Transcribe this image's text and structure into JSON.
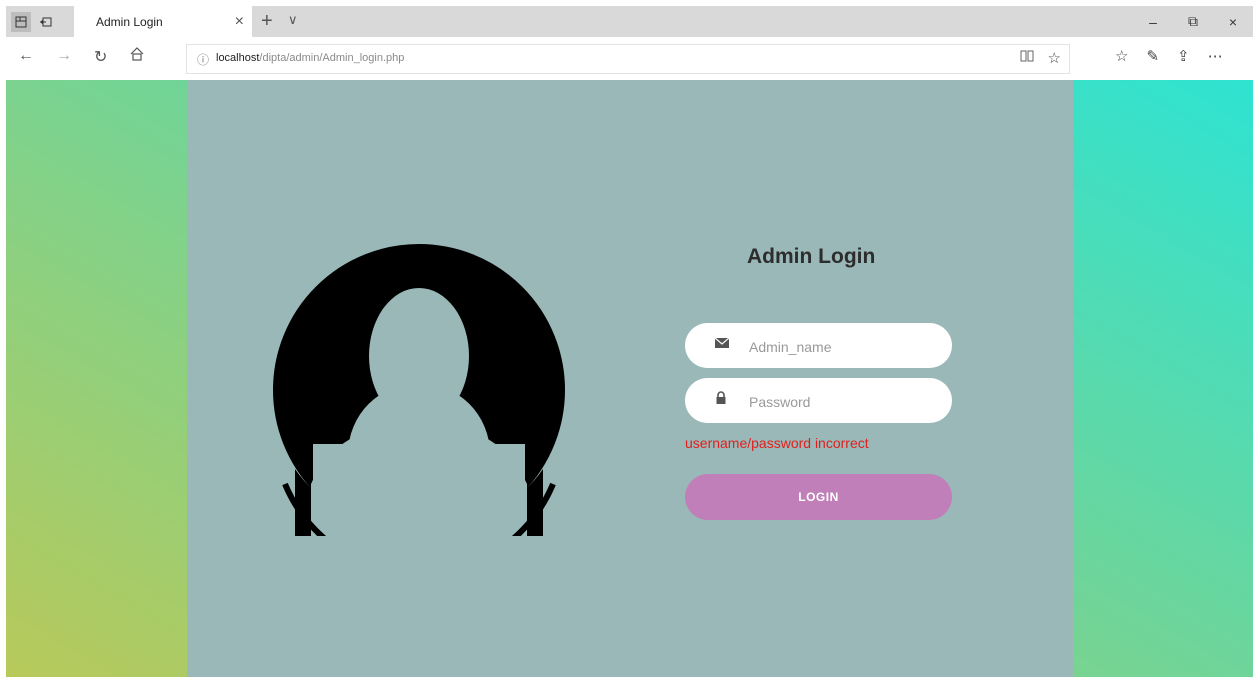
{
  "browser": {
    "tab_title": "Admin Login",
    "tab_close": "×",
    "new_tab": "+",
    "tab_menu": "∨",
    "address_host": "localhost",
    "address_path": "/dipta/admin/Admin_login.php",
    "window_controls": {
      "minimize": "–",
      "restore": "⧉",
      "close": "×"
    }
  },
  "login": {
    "title": "Admin Login",
    "username_placeholder": "Admin_name",
    "password_placeholder": "Password",
    "error": "username/password incorrect",
    "button_label": "LOGIN"
  },
  "colors": {
    "panel": "#9ab8b8",
    "button": "#c07fb9",
    "error": "#e0201e",
    "gradient_start": "#2ee3d2",
    "gradient_end": "#b8c95a"
  }
}
